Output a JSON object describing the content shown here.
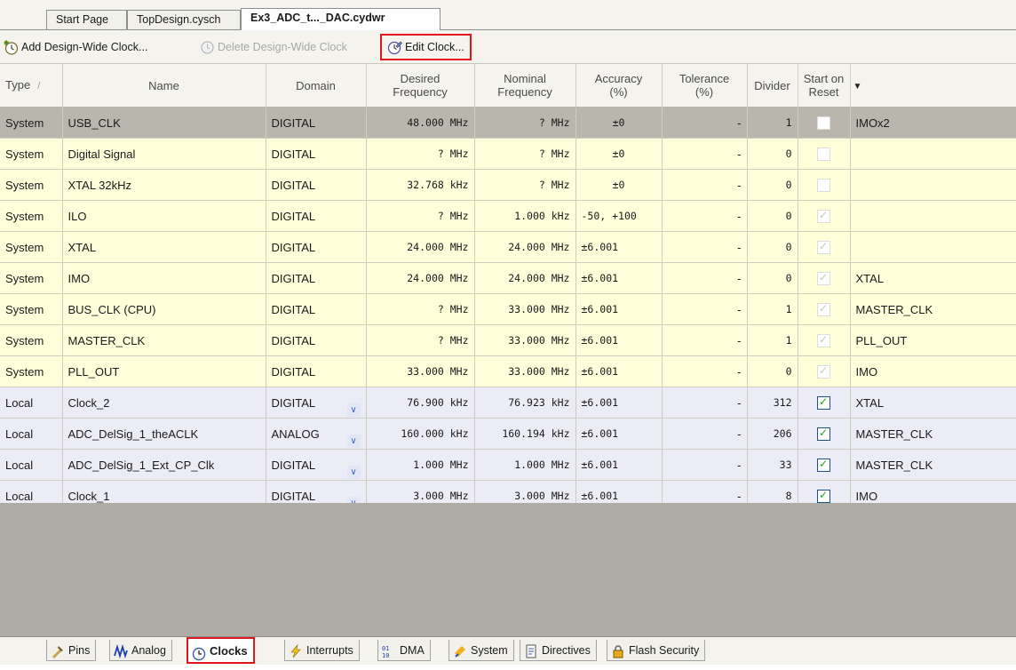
{
  "tabs": [
    "Start Page",
    "TopDesign.cysch",
    "Ex3_ADC_t..._DAC.cydwr"
  ],
  "toolbar": {
    "add_label": "Add Design-Wide Clock...",
    "delete_label": "Delete Design-Wide Clock",
    "edit_label": "Edit Clock..."
  },
  "columns": {
    "type": "Type",
    "name": "Name",
    "domain": "Domain",
    "desired_1": "Desired",
    "desired_2": "Frequency",
    "nominal_1": "Nominal",
    "nominal_2": "Frequency",
    "accuracy_1": "Accuracy",
    "accuracy_2": "(%)",
    "tolerance_1": "Tolerance",
    "tolerance_2": "(%)",
    "divider": "Divider",
    "start_1": "Start on",
    "start_2": "Reset"
  },
  "rows": [
    {
      "type": "System",
      "name": "USB_CLK",
      "domain": "DIGITAL",
      "desired": "48.000 MHz",
      "nominal": "? MHz",
      "accuracy": "±0",
      "tolerance": "-",
      "divider": "1",
      "start": "unchecked",
      "source": "IMOx2"
    },
    {
      "type": "System",
      "name": "Digital Signal",
      "domain": "DIGITAL",
      "desired": "? MHz",
      "nominal": "? MHz",
      "accuracy": "±0",
      "tolerance": "-",
      "divider": "0",
      "start": "unchecked",
      "source": ""
    },
    {
      "type": "System",
      "name": "XTAL 32kHz",
      "domain": "DIGITAL",
      "desired": "32.768 kHz",
      "nominal": "? MHz",
      "accuracy": "±0",
      "tolerance": "-",
      "divider": "0",
      "start": "unchecked",
      "source": ""
    },
    {
      "type": "System",
      "name": "ILO",
      "domain": "DIGITAL",
      "desired": "? MHz",
      "nominal": "1.000 kHz",
      "accuracy": "-50, +100",
      "tolerance": "-",
      "divider": "0",
      "start": "checked-disabled",
      "source": ""
    },
    {
      "type": "System",
      "name": "XTAL",
      "domain": "DIGITAL",
      "desired": "24.000 MHz",
      "nominal": "24.000 MHz",
      "accuracy": "±6.001",
      "tolerance": "-",
      "divider": "0",
      "start": "checked-disabled",
      "source": ""
    },
    {
      "type": "System",
      "name": "IMO",
      "domain": "DIGITAL",
      "desired": "24.000 MHz",
      "nominal": "24.000 MHz",
      "accuracy": "±6.001",
      "tolerance": "-",
      "divider": "0",
      "start": "checked-disabled",
      "source": "XTAL"
    },
    {
      "type": "System",
      "name": "BUS_CLK (CPU)",
      "domain": "DIGITAL",
      "desired": "? MHz",
      "nominal": "33.000 MHz",
      "accuracy": "±6.001",
      "tolerance": "-",
      "divider": "1",
      "start": "checked-disabled",
      "source": "MASTER_CLK"
    },
    {
      "type": "System",
      "name": "MASTER_CLK",
      "domain": "DIGITAL",
      "desired": "? MHz",
      "nominal": "33.000 MHz",
      "accuracy": "±6.001",
      "tolerance": "-",
      "divider": "1",
      "start": "checked-disabled",
      "source": "PLL_OUT"
    },
    {
      "type": "System",
      "name": "PLL_OUT",
      "domain": "DIGITAL",
      "desired": "33.000 MHz",
      "nominal": "33.000 MHz",
      "accuracy": "±6.001",
      "tolerance": "-",
      "divider": "0",
      "start": "checked-disabled",
      "source": "IMO"
    },
    {
      "type": "Local",
      "name": "Clock_2",
      "domain": "DIGITAL",
      "desired": "76.900 kHz",
      "nominal": "76.923 kHz",
      "accuracy": "±6.001",
      "tolerance": "-",
      "divider": "312",
      "start": "checked",
      "source": "XTAL"
    },
    {
      "type": "Local",
      "name": "ADC_DelSig_1_theACLK",
      "domain": "ANALOG",
      "desired": "160.000 kHz",
      "nominal": "160.194 kHz",
      "accuracy": "±6.001",
      "tolerance": "-",
      "divider": "206",
      "start": "checked",
      "source": "MASTER_CLK"
    },
    {
      "type": "Local",
      "name": "ADC_DelSig_1_Ext_CP_Clk",
      "domain": "DIGITAL",
      "desired": "1.000 MHz",
      "nominal": "1.000 MHz",
      "accuracy": "±6.001",
      "tolerance": "-",
      "divider": "33",
      "start": "checked",
      "source": "MASTER_CLK"
    },
    {
      "type": "Local",
      "name": "Clock_1",
      "domain": "DIGITAL",
      "desired": "3.000 MHz",
      "nominal": "3.000 MHz",
      "accuracy": "±6.001",
      "tolerance": "-",
      "divider": "8",
      "start": "checked",
      "source": "IMO"
    }
  ],
  "bottom_tabs": [
    "Pins",
    "Analog",
    "Clocks",
    "Interrupts",
    "DMA",
    "System",
    "Directives",
    "Flash Security"
  ],
  "active_bottom_tab": "Clocks",
  "colors": {
    "highlight_red": "#e2161c",
    "system_row": "#ffffd9",
    "local_row": "#ececf7",
    "selected_row": "#b9b6ad"
  }
}
